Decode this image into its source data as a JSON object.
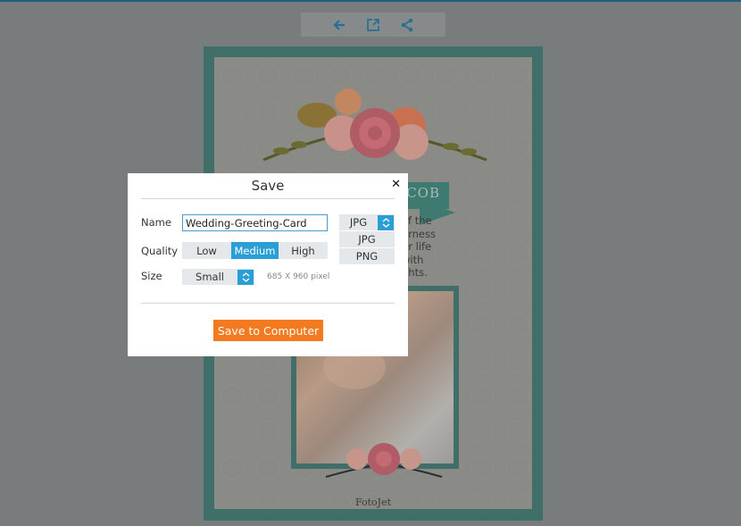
{
  "toolbar": {
    "buttons": [
      {
        "icon": "arrow-left-icon",
        "label": "Back"
      },
      {
        "icon": "open-external-icon",
        "label": "Open"
      },
      {
        "icon": "share-icon",
        "label": "Share"
      }
    ],
    "icon_color": "#2a6f93"
  },
  "card": {
    "ribbon_text": "COB",
    "text_lines": [
      "of the",
      "erness",
      "ur life",
      "with",
      "ghts."
    ],
    "brand": "FotoJet",
    "frame_color": "#3f6f68"
  },
  "dialog": {
    "title": "Save",
    "close_icon": "close-icon",
    "name_label": "Name",
    "name_value": "Wedding-Greeting-Card",
    "quality_label": "Quality",
    "quality_options": [
      "Low",
      "Medium",
      "High"
    ],
    "quality_selected": "Medium",
    "size_label": "Size",
    "size_value": "Small",
    "size_note": "685 X 960 pixel",
    "format_value": "JPG",
    "format_options": [
      "JPG",
      "PNG"
    ],
    "save_button": "Save to Computer",
    "accent_color": "#2a9ed6",
    "save_color": "#f47a20"
  }
}
